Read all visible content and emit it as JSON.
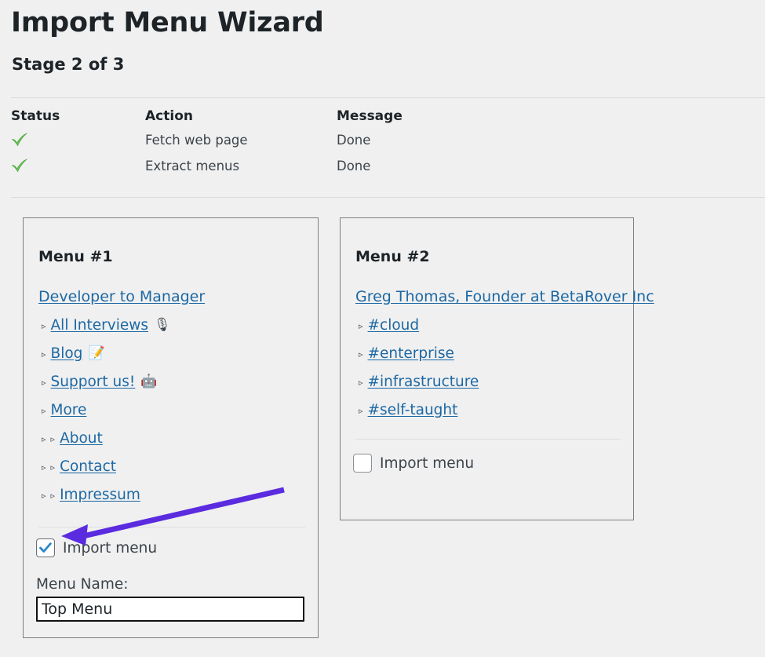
{
  "header": {
    "title": "Import Menu Wizard",
    "subtitle": "Stage 2 of 3"
  },
  "status_table": {
    "columns": [
      "Status",
      "Action",
      "Message"
    ],
    "rows": [
      {
        "status_icon": "green-check-icon",
        "action": "Fetch web page",
        "message": "Done"
      },
      {
        "status_icon": "green-check-icon",
        "action": "Extract menus",
        "message": "Done"
      }
    ]
  },
  "panels": [
    {
      "title": "Menu #1",
      "items": [
        {
          "level": 0,
          "label": "Developer to Manager",
          "emoji": ""
        },
        {
          "level": 1,
          "label": "All Interviews",
          "emoji": "🎙"
        },
        {
          "level": 1,
          "label": "Blog",
          "emoji": "📝"
        },
        {
          "level": 1,
          "label": "Support us!",
          "emoji": "🤖"
        },
        {
          "level": 1,
          "label": "More",
          "emoji": ""
        },
        {
          "level": 2,
          "label": "About",
          "emoji": ""
        },
        {
          "level": 2,
          "label": "Contact",
          "emoji": ""
        },
        {
          "level": 2,
          "label": "Impressum",
          "emoji": ""
        }
      ],
      "import_checkbox": {
        "label": "Import menu",
        "checked": true
      },
      "menu_name": {
        "label": "Menu Name:",
        "value": "Top Menu",
        "placeholder": ""
      }
    },
    {
      "title": "Menu #2",
      "items": [
        {
          "level": 0,
          "label": "Greg Thomas, Founder at BetaRover Inc",
          "emoji": ""
        },
        {
          "level": 1,
          "label": "#cloud",
          "emoji": ""
        },
        {
          "level": 1,
          "label": "#enterprise",
          "emoji": ""
        },
        {
          "level": 1,
          "label": "#infrastructure",
          "emoji": ""
        },
        {
          "level": 1,
          "label": "#self-taught",
          "emoji": ""
        }
      ],
      "import_checkbox": {
        "label": "Import menu",
        "checked": false
      }
    }
  ],
  "annotation": {
    "type": "arrow",
    "color": "#5b2be0",
    "points_to": "import-menu-checkbox-1"
  },
  "colors": {
    "page_background": "#f0f0f0",
    "link": "#1c68a4",
    "heading": "#1d2327",
    "text": "#3c434a",
    "panel_border": "#7d7d7d",
    "rule": "#dcdcdc",
    "check_green": "#5fc24b",
    "checkbox_check": "#2b87c9",
    "annotation_purple": "#5b2be0"
  },
  "bullet_glyph": "▹"
}
